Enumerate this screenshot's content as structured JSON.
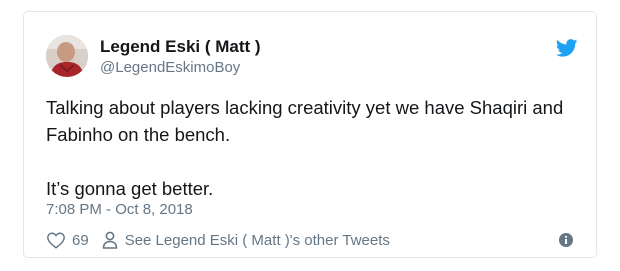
{
  "tweet": {
    "author": {
      "display_name": "Legend Eski ( Matt )",
      "handle": "@LegendEskimoBoy",
      "avatar_icon": "user-avatar-photo"
    },
    "brand_icon": "twitter-bird-icon",
    "text": "Talking about players lacking creativity yet we have Shaqiri and Fabinho on the bench.\n\nIt’s gonna get better.",
    "timestamp": "7:08 PM - Oct 8, 2018",
    "actions": {
      "like_icon": "heart-icon",
      "like_count": "69",
      "profile_icon": "person-icon",
      "profile_link": "See Legend Eski ( Matt )'s other Tweets",
      "info_icon": "info-icon"
    }
  },
  "colors": {
    "text_primary": "#14171a",
    "text_secondary": "#657786",
    "twitter_blue": "#1da1f2",
    "border": "#e1e8ed"
  }
}
